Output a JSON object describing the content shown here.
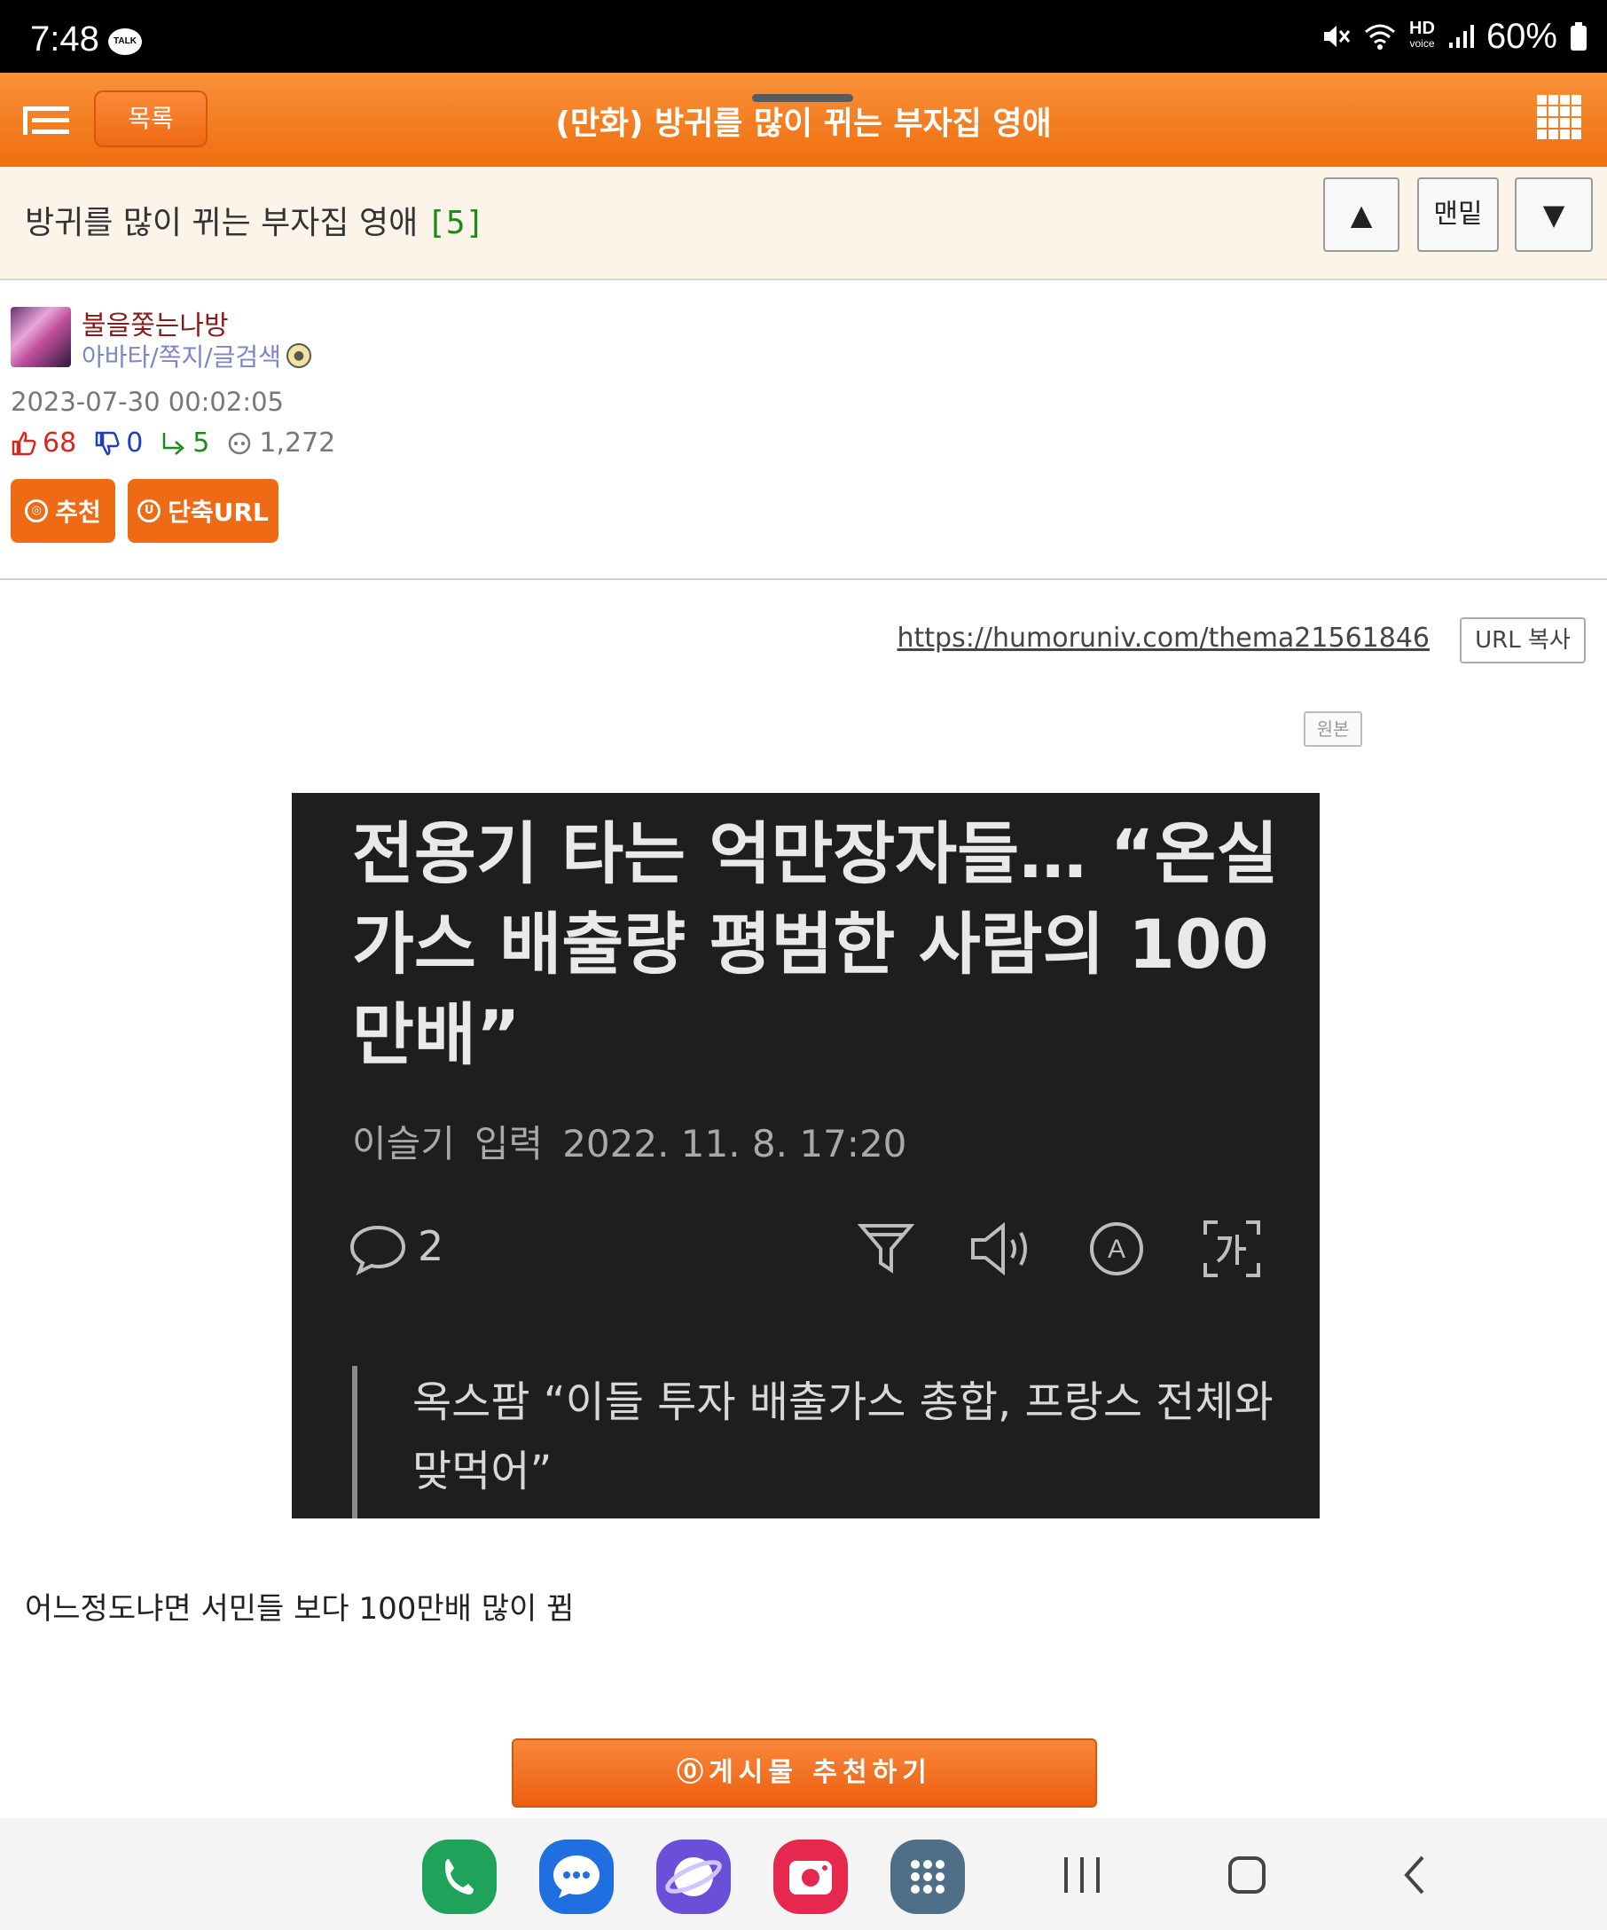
{
  "status_bar": {
    "time": "7:48",
    "talk_badge": "TALK",
    "hd_label": "HD",
    "voice_label": "voice",
    "battery_percent": "60%",
    "icons": [
      "mute-icon",
      "wifi-icon",
      "signal-icon",
      "battery-icon"
    ]
  },
  "header": {
    "list_button": "목록",
    "title": "(만화) 방귀를 많이 뀌는 부자집 영애",
    "icons": [
      "menu-icon",
      "apps-grid-icon"
    ]
  },
  "subheader": {
    "title": "방귀를 많이 뀌는 부자집 영애",
    "comment_count": "[5]",
    "up_symbol": "▲",
    "bottom_label": "맨밑",
    "down_symbol": "▼"
  },
  "author": {
    "name": "불을쫓는나방",
    "links": "아바타/쪽지/글검색",
    "date": "2023-07-30 00:02:05"
  },
  "stats": {
    "likes": "68",
    "dislikes": "0",
    "replies": "5",
    "views": "1,272"
  },
  "actions": {
    "recommend_icon_text": "◎",
    "recommend": "추천",
    "short_url_icon_text": "U",
    "short_url": "단축URL"
  },
  "url": {
    "link": "https://humoruniv.com/thema21561846",
    "copy": "URL 복사"
  },
  "original_label": "원본",
  "news_image": {
    "headline": "전용기 타는 억만장자들… “온실가스 배출량 평범한 사람의 100만배”",
    "reporter": "이슬기",
    "input_label": "입력",
    "datetime": "2022. 11. 8. 17:20",
    "comment_count": "2",
    "subheadline": "옥스팜 “이들 투자 배출가스 총합, 프랑스 전체와 맞먹어”",
    "icons": [
      "comment-icon",
      "filter-icon",
      "speaker-icon",
      "auto-translate-icon",
      "font-size-icon"
    ]
  },
  "body_text": "어느정도냐면 서민들 보다 100만배 많이 뀜",
  "recommend_bar": "⓪게시물 추천하기",
  "nav_bar": {
    "apps": [
      "phone-app-icon",
      "messages-app-icon",
      "internet-app-icon",
      "camera-app-icon",
      "app-drawer-icon"
    ],
    "buttons": [
      "recents-button",
      "home-button",
      "back-button"
    ]
  }
}
